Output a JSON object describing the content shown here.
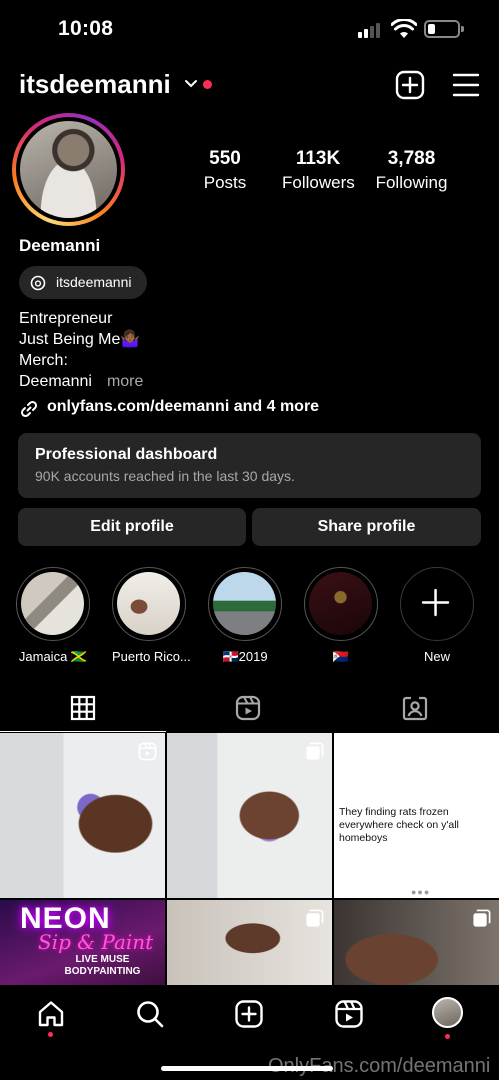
{
  "status_bar": {
    "time": "10:08"
  },
  "header": {
    "username": "itsdeemanni",
    "accent_color": "#ff2d55"
  },
  "profile": {
    "stats": [
      {
        "value": "550",
        "label": "Posts"
      },
      {
        "value": "113K",
        "label": "Followers"
      },
      {
        "value": "3,788",
        "label": "Following"
      }
    ],
    "display_name": "Deemanni",
    "threads_handle": "itsdeemanni",
    "bio_lines": [
      "Entrepreneur",
      "Just Being Me🤷🏾‍♀️",
      "Merch:",
      "Deemanni"
    ],
    "bio_more": "more",
    "link_text": "onlyfans.com/deemanni and 4 more"
  },
  "dashboard": {
    "title": "Professional dashboard",
    "subtitle": "90K accounts reached in the last 30 days."
  },
  "actions": {
    "edit": "Edit profile",
    "share": "Share profile"
  },
  "highlights": [
    {
      "label": "Jamaica 🇯🇲"
    },
    {
      "label": "Puerto Rico..."
    },
    {
      "label": "🇩🇴2019"
    },
    {
      "label": "🇸🇽"
    },
    {
      "label": "New"
    }
  ],
  "tabs": [
    {
      "icon": "grid-icon",
      "active": true
    },
    {
      "icon": "reels-icon",
      "active": false
    },
    {
      "icon": "tagged-icon",
      "active": false
    }
  ],
  "posts": {
    "tweet_text": "They finding rats frozen everywhere check on y'all homeboys",
    "neon_title": "NEON",
    "neon_sub": "Sip & Paint",
    "neon_caption": "LIVE MUSE BODYPAINTING"
  },
  "bottom_nav": [
    "home-icon",
    "search-icon",
    "create-icon",
    "reels-icon",
    "profile-avatar"
  ],
  "watermark": "OnlyFans.com/deemanni"
}
